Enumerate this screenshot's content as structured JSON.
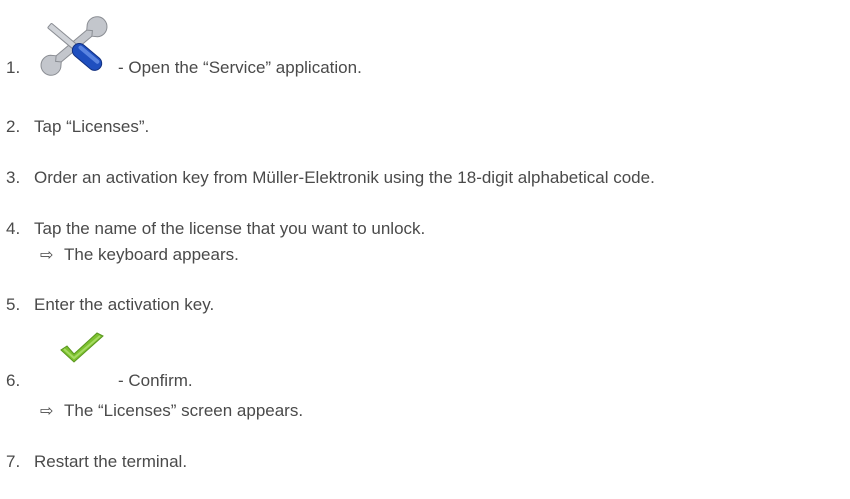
{
  "steps": [
    {
      "num": "1.",
      "text": " - Open the “Service” application.",
      "icon": "service-tools-icon"
    },
    {
      "num": "2.",
      "text": "Tap “Licenses”."
    },
    {
      "num": "3.",
      "text": "Order an activation key from Müller-Elektronik using the 18-digit alphabetical code."
    },
    {
      "num": "4.",
      "text": "Tap the name of the license that you want to unlock."
    },
    {
      "num": "5.",
      "text": "Enter the activation key."
    },
    {
      "num": "6.",
      "text": " - Confirm.",
      "icon": "checkmark-icon"
    },
    {
      "num": "7.",
      "text": "Restart the terminal."
    }
  ],
  "results": {
    "step4": "The keyboard appears.",
    "step6": "The “Licenses” screen appears."
  },
  "arrow_symbol": "⇨",
  "colors": {
    "text": "#4a4a4a",
    "wrench_handle": "#1f4fbf",
    "wrench_metal": "#b9bcc2",
    "check_green": "#7cc12e"
  }
}
